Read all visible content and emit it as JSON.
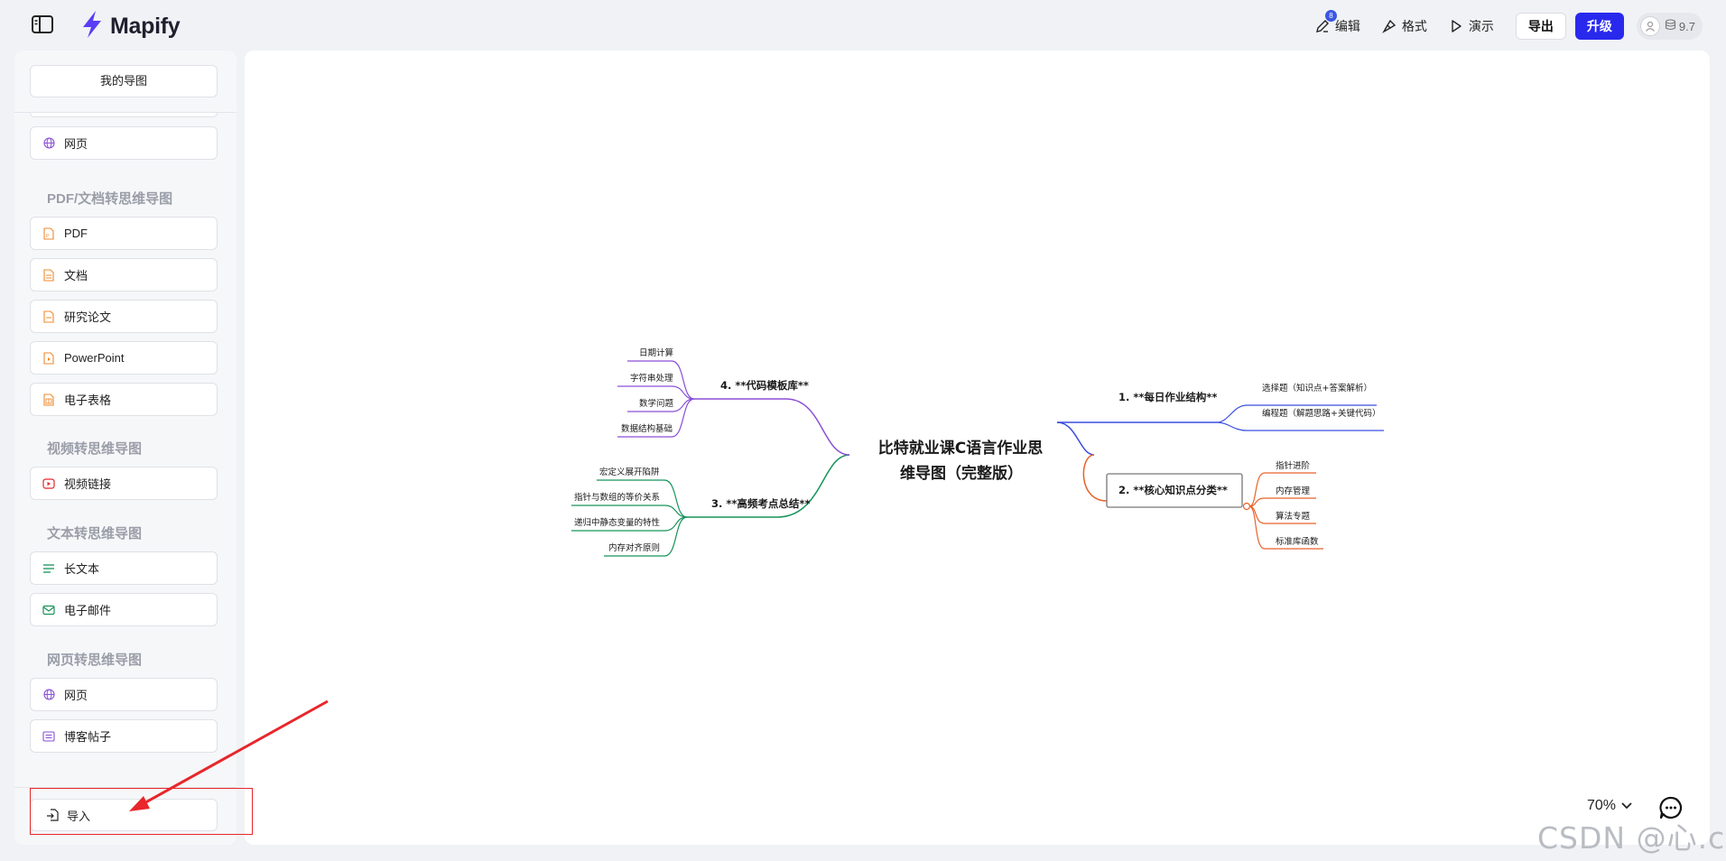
{
  "app": {
    "name": "Mapify"
  },
  "toolbar": {
    "edit_label": "编辑",
    "edit_badge": "8",
    "format_label": "格式",
    "present_label": "演示",
    "export_label": "导出",
    "upgrade_label": "升级",
    "credits": "9.7"
  },
  "sidebar": {
    "my_maps": "我的导图",
    "top_item": "网页",
    "sections": [
      {
        "title": "PDF/文档转思维导图",
        "items": [
          "PDF",
          "文档",
          "研究论文",
          "PowerPoint",
          "电子表格"
        ]
      },
      {
        "title": "视频转思维导图",
        "items": [
          "视频链接"
        ]
      },
      {
        "title": "文本转思维导图",
        "items": [
          "长文本",
          "电子邮件"
        ]
      },
      {
        "title": "网页转思维导图",
        "items": [
          "网页",
          "博客帖子"
        ]
      }
    ],
    "import_label": "导入"
  },
  "mindmap": {
    "root": "比特就业课C语言作业思维导图（完整版）",
    "branches": [
      {
        "label": "1. **每日作业结构**",
        "color": "#3a4de0",
        "children": [
          "选择题（知识点+答案解析）",
          "编程题（解题思路+关键代码）"
        ]
      },
      {
        "label": "2. **核心知识点分类**",
        "color": "#e8622a",
        "children": [
          "指针进阶",
          "内存管理",
          "算法专题",
          "标准库函数"
        ]
      },
      {
        "label": "3. **高频考点总结**",
        "color": "#17935a",
        "children": [
          "宏定义展开陷阱",
          "指针与数组的等价关系",
          "递归中静态变量的特性",
          "内存对齐原则"
        ]
      },
      {
        "label": "4. **代码模板库**",
        "color": "#8a4fd6",
        "children": [
          "日期计算",
          "字符串处理",
          "数学问题",
          "数据结构基础"
        ]
      }
    ]
  },
  "zoom": "70%",
  "watermark": "CSDN @心.c",
  "colors": {
    "accent": "#2929ee",
    "highlight": "#e8262b"
  }
}
